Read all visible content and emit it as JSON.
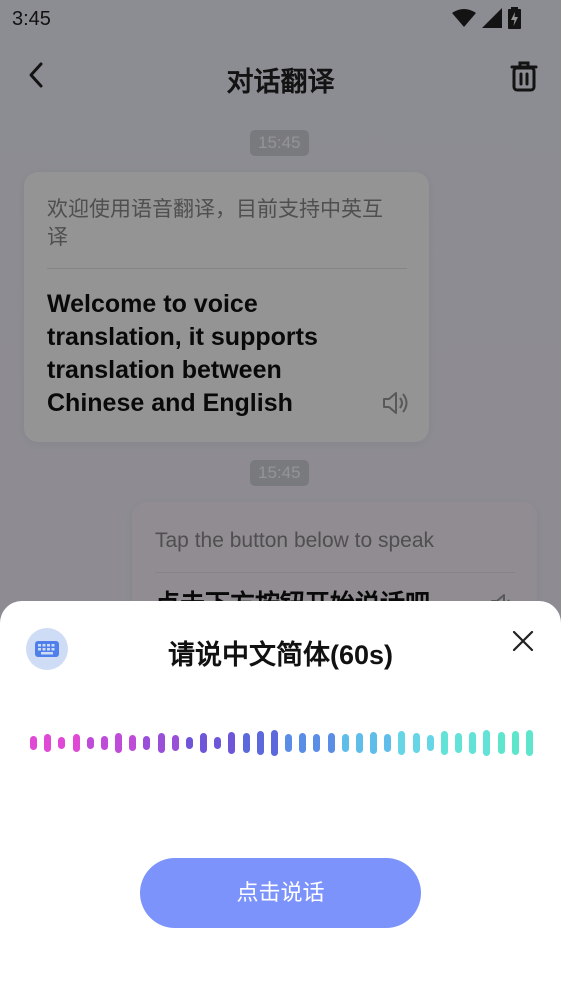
{
  "status_bar": {
    "time": "3:45"
  },
  "header": {
    "title": "对话翻译"
  },
  "chat": {
    "messages": [
      {
        "timestamp": "15:45",
        "source_text": "欢迎使用语音翻译，目前支持中英互译",
        "translated_text": "Welcome to voice translation, it supports translation between Chinese and English"
      },
      {
        "timestamp": "15:45",
        "source_text": "Tap the button below to speak",
        "translated_text": "点击下方按钮开始说话吧"
      }
    ]
  },
  "sheet": {
    "title": "请说中文简体(60s)",
    "speak_button": "点击说话",
    "wave_colors": [
      "#e048d6",
      "#bf4cd8",
      "#9a4fd8",
      "#6f56d8",
      "#5b69dc",
      "#5a8de6",
      "#5fbde9",
      "#66d6e6",
      "#63e3d7",
      "#5ee6cc"
    ],
    "icons": {
      "keyboard": "keyboard-icon",
      "close": "close-icon"
    }
  },
  "colors": {
    "accent": "#7c93fb",
    "keyboard_bg": "#cfdcf6"
  }
}
